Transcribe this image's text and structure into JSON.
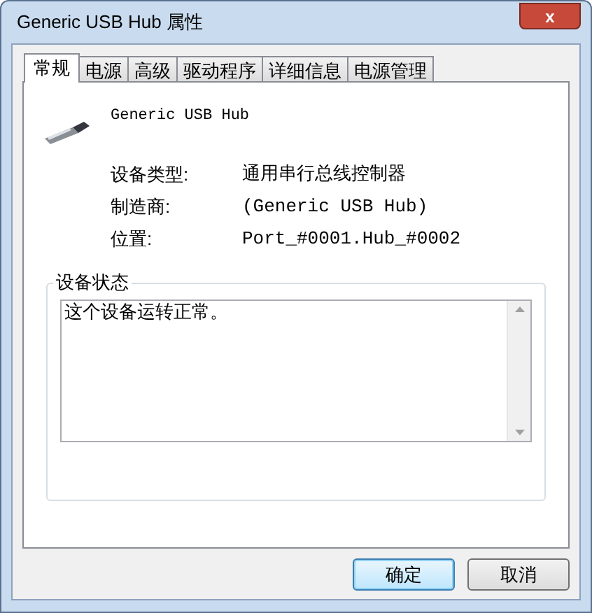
{
  "window": {
    "title": "Generic USB Hub 属性",
    "close": "x"
  },
  "tabs": [
    {
      "label": "常规",
      "selected": true
    },
    {
      "label": "电源",
      "selected": false
    },
    {
      "label": "高级",
      "selected": false
    },
    {
      "label": "驱动程序",
      "selected": false
    },
    {
      "label": "详细信息",
      "selected": false
    },
    {
      "label": "电源管理",
      "selected": false
    }
  ],
  "device": {
    "name": "Generic USB Hub",
    "properties": [
      {
        "label": "设备类型:",
        "value": "通用串行总线控制器"
      },
      {
        "label": "制造商:",
        "value": "(Generic USB Hub)"
      },
      {
        "label": "位置:",
        "value": "Port_#0001.Hub_#0002"
      }
    ]
  },
  "status": {
    "title": "设备状态",
    "text": "这个设备运转正常。"
  },
  "buttons": [
    {
      "label": "确定",
      "default": true
    },
    {
      "label": "取消",
      "default": false
    }
  ]
}
